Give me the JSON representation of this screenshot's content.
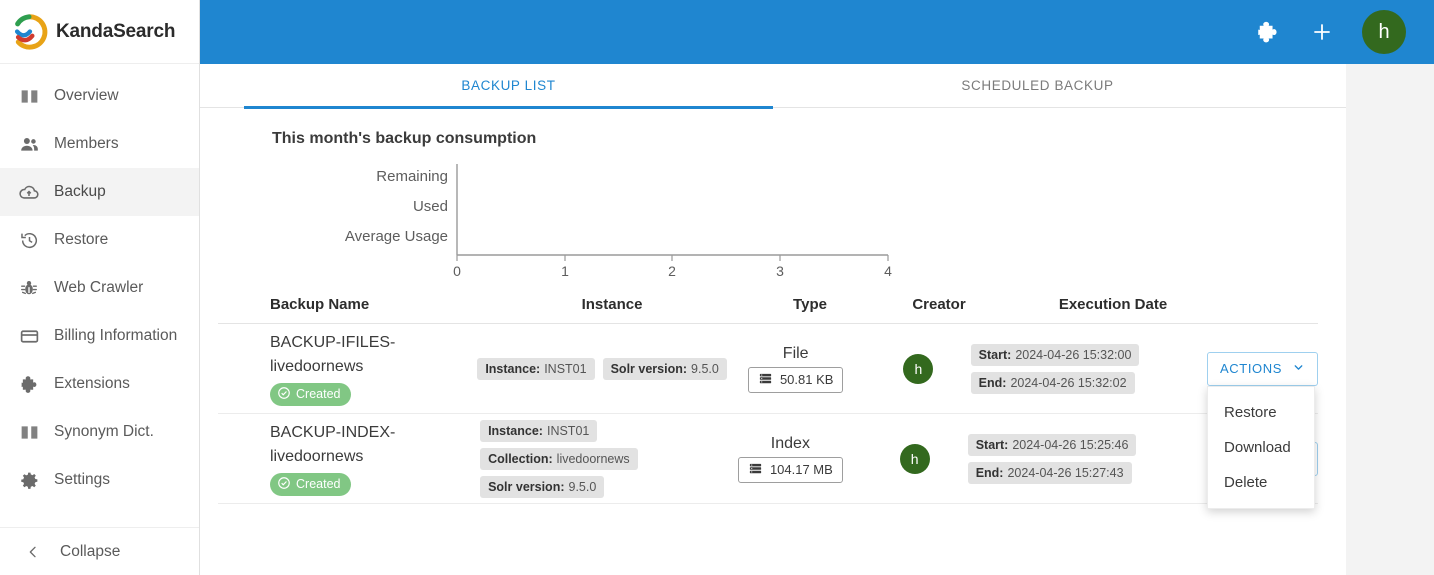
{
  "brand": {
    "name": "KandaSearch",
    "logo_icon": "kandasearch-logo-icon"
  },
  "sidebar": {
    "items": [
      {
        "label": "Overview",
        "icon": "book-icon",
        "active": false
      },
      {
        "label": "Members",
        "icon": "people-icon",
        "active": false
      },
      {
        "label": "Backup",
        "icon": "cloud-upload-icon",
        "active": true
      },
      {
        "label": "Restore",
        "icon": "history-icon",
        "active": false
      },
      {
        "label": "Web Crawler",
        "icon": "bug-icon",
        "active": false
      },
      {
        "label": "Billing Information",
        "icon": "credit-card-icon",
        "active": false
      },
      {
        "label": "Extensions",
        "icon": "puzzle-icon",
        "active": false
      },
      {
        "label": "Synonym Dict.",
        "icon": "book-icon",
        "active": false
      },
      {
        "label": "Settings",
        "icon": "gear-icon",
        "active": false
      }
    ],
    "collapse": {
      "label": "Collapse",
      "icon": "chevron-left-icon"
    }
  },
  "topbar": {
    "background": "#1f86d0",
    "extensions_icon": "puzzle-icon",
    "add_icon": "plus-icon",
    "avatar_initial": "h",
    "avatar_color": "#33691e"
  },
  "tabs": [
    {
      "label": "BACKUP LIST",
      "active": true
    },
    {
      "label": "SCHEDULED BACKUP",
      "active": false
    }
  ],
  "consumption": {
    "title": "This month's backup consumption"
  },
  "chart_data": {
    "type": "bar",
    "orientation": "horizontal",
    "title": "This month's backup consumption",
    "categories": [
      "Remaining",
      "Used",
      "Average Usage"
    ],
    "values": [
      0,
      0,
      0
    ],
    "xlabel": "",
    "ylabel": "",
    "xticks": [
      "0",
      "1",
      "2",
      "3",
      "4"
    ],
    "xlim": [
      0,
      4
    ],
    "grid": false,
    "legend": false
  },
  "table": {
    "headers": {
      "name": "Backup Name",
      "instance": "Instance",
      "type": "Type",
      "creator": "Creator",
      "date": "Execution Date"
    },
    "rows": [
      {
        "name": "BACKUP-IFILES-livedoornews",
        "status": "Created",
        "status_icon": "check-circle-icon",
        "chips": [
          {
            "key": "Instance:",
            "value": "INST01"
          },
          {
            "key": "Solr version:",
            "value": "9.5.0"
          }
        ],
        "chip_layout": "inline",
        "type": "File",
        "size": "50.81 KB",
        "size_icon": "server-icon",
        "creator_initial": "h",
        "start_key": "Start:",
        "start_value": "2024-04-26 15:32:00",
        "end_key": "End:",
        "end_value": "2024-04-26 15:32:02",
        "actions_label": "ACTIONS",
        "menu_open": true
      },
      {
        "name": "BACKUP-INDEX-livedoornews",
        "status": "Created",
        "status_icon": "check-circle-icon",
        "chips": [
          {
            "key": "Instance:",
            "value": "INST01"
          },
          {
            "key": "Collection:",
            "value": "livedoornews"
          },
          {
            "key": "Solr version:",
            "value": "9.5.0"
          }
        ],
        "chip_layout": "stacked",
        "type": "Index",
        "size": "104.17 MB",
        "size_icon": "server-icon",
        "creator_initial": "h",
        "start_key": "Start:",
        "start_value": "2024-04-26 15:25:46",
        "end_key": "End:",
        "end_value": "2024-04-26 15:27:43",
        "actions_label": "ACTIONS",
        "menu_open": false
      }
    ]
  },
  "actions_menu": {
    "items": [
      {
        "label": "Restore"
      },
      {
        "label": "Download"
      },
      {
        "label": "Delete"
      }
    ]
  },
  "colors": {
    "accent": "#1f86d0",
    "status_green": "#81c784",
    "avatar_green": "#33691e",
    "chip_gray": "#e2e2e2"
  }
}
